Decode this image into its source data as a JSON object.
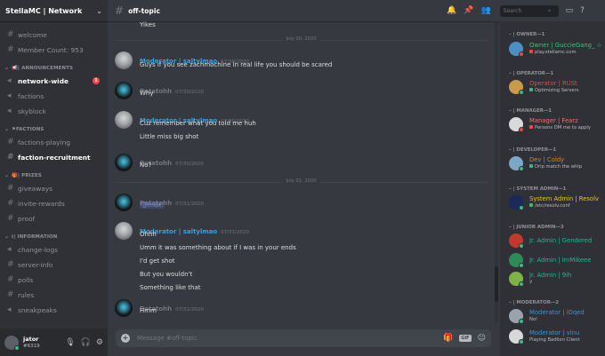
{
  "server": {
    "name": "StellaMC | Network",
    "channels_top": [
      {
        "label": "welcome"
      },
      {
        "label": "Member Count: 953"
      }
    ],
    "categories": [
      {
        "label": "| ANNOUNCEMENTS",
        "channels": [
          {
            "label": "network-wide",
            "bold": true,
            "badge": "1"
          },
          {
            "label": "factions"
          },
          {
            "label": "skyblock"
          }
        ]
      },
      {
        "label": "FACTIONS",
        "channels": [
          {
            "label": "factions-playing"
          },
          {
            "label": "faction-recruitment",
            "bold": true
          }
        ]
      },
      {
        "label": "| PRIZES",
        "channels": [
          {
            "label": "giveaways"
          },
          {
            "label": "invite-rewards"
          },
          {
            "label": "proof"
          }
        ]
      },
      {
        "label": "| INFORMATION",
        "channels": [
          {
            "label": "change-logs"
          },
          {
            "label": "server-info"
          },
          {
            "label": "polls"
          },
          {
            "label": "rules"
          },
          {
            "label": "sneakpeaks"
          }
        ]
      }
    ]
  },
  "user": {
    "name": "jator",
    "tag": "#6319"
  },
  "channel": {
    "title": "off-topic"
  },
  "messages": {
    "first_line": "Yikes",
    "divider_1": "July 30, 2020",
    "divider_2": "July 31, 2020",
    "mod_name": "Moderator | saltylmao",
    "pot_name": "Potatohh",
    "groups": [
      {
        "time": "07/30/2020",
        "lines": [
          "Guys if you see zachmochine in real life you should be scared"
        ]
      },
      {
        "time": "07/30/2020",
        "lines": [
          "Why"
        ]
      },
      {
        "time": "07/30/2020",
        "lines": [
          "Cuz remember what you told me huh",
          "Little miss big shot"
        ]
      },
      {
        "time": "07/30/2020",
        "lines": [
          "No?"
        ]
      },
      {
        "time": "07/31/2020",
        "lines": [
          "@max."
        ]
      },
      {
        "time": "07/31/2020",
        "lines": [
          "Ohhh",
          "Umm it was something about if I was in your ends",
          "I'd get shot",
          "But you wouldn't",
          "Something like that"
        ]
      },
      {
        "time": "07/31/2020",
        "lines": [
          "Hmm"
        ]
      }
    ]
  },
  "composer": {
    "placeholder": "Message #off-topic",
    "gif_label": "GIF"
  },
  "search": {
    "placeholder": "Search"
  },
  "members": {
    "roles": [
      {
        "label": "OWNER—1",
        "members": [
          {
            "name": "Owner | GuccieGang_ ☆",
            "status": "play.stellamc.com",
            "color": "#2ecc71",
            "status_color": "#f04747"
          }
        ]
      },
      {
        "label": "OPERATOR—1",
        "members": [
          {
            "name": "Operator | RUSt",
            "status": "Optimizing Servers",
            "color": "#e74c3c",
            "status_color": "#43b581"
          }
        ]
      },
      {
        "label": "MANAGER—1",
        "members": [
          {
            "name": "Manager | Fearz",
            "status": "Persons DM me to apply",
            "color": "#ff6b6b",
            "status_color": "#f04747"
          }
        ]
      },
      {
        "label": "DEVELOPER—1",
        "members": [
          {
            "name": "Dev | Coldy",
            "status": "Drip match the whip",
            "color": "#e67e22",
            "status_color": "#43b581"
          }
        ]
      },
      {
        "label": "SYSTEM ADMIN—1",
        "members": [
          {
            "name": "System Admin | Resolv",
            "status": "/etc/resolv.conf",
            "color": "#f1c40f",
            "status_color": "#43b581"
          }
        ]
      },
      {
        "label": "JUNIOR ADMIN—3",
        "members": [
          {
            "name": "Jr. Admin | Gendered",
            "status": "",
            "color": "#1abc9c",
            "status_color": "#43b581"
          },
          {
            "name": "Jr. Admin | ImMikeee",
            "status": "",
            "color": "#1abc9c",
            "status_color": "#43b581"
          },
          {
            "name": "Jr. Admin | 9ih",
            "status": "ﻻ",
            "color": "#1abc9c",
            "status_color": "#43b581"
          }
        ]
      },
      {
        "label": "MODERATOR—2",
        "members": [
          {
            "name": "Moderator | iDqed",
            "status": "No!",
            "color": "#3498db",
            "status_color": "#43b581"
          },
          {
            "name": "Moderator | vlnu",
            "status": "Playing Badlion Client",
            "color": "#3498db",
            "status_color": "#43b581"
          }
        ]
      }
    ]
  },
  "colors": {
    "mod_name": "#3aa0dc",
    "pot_name": "#72767d",
    "mention": "#7289da"
  }
}
